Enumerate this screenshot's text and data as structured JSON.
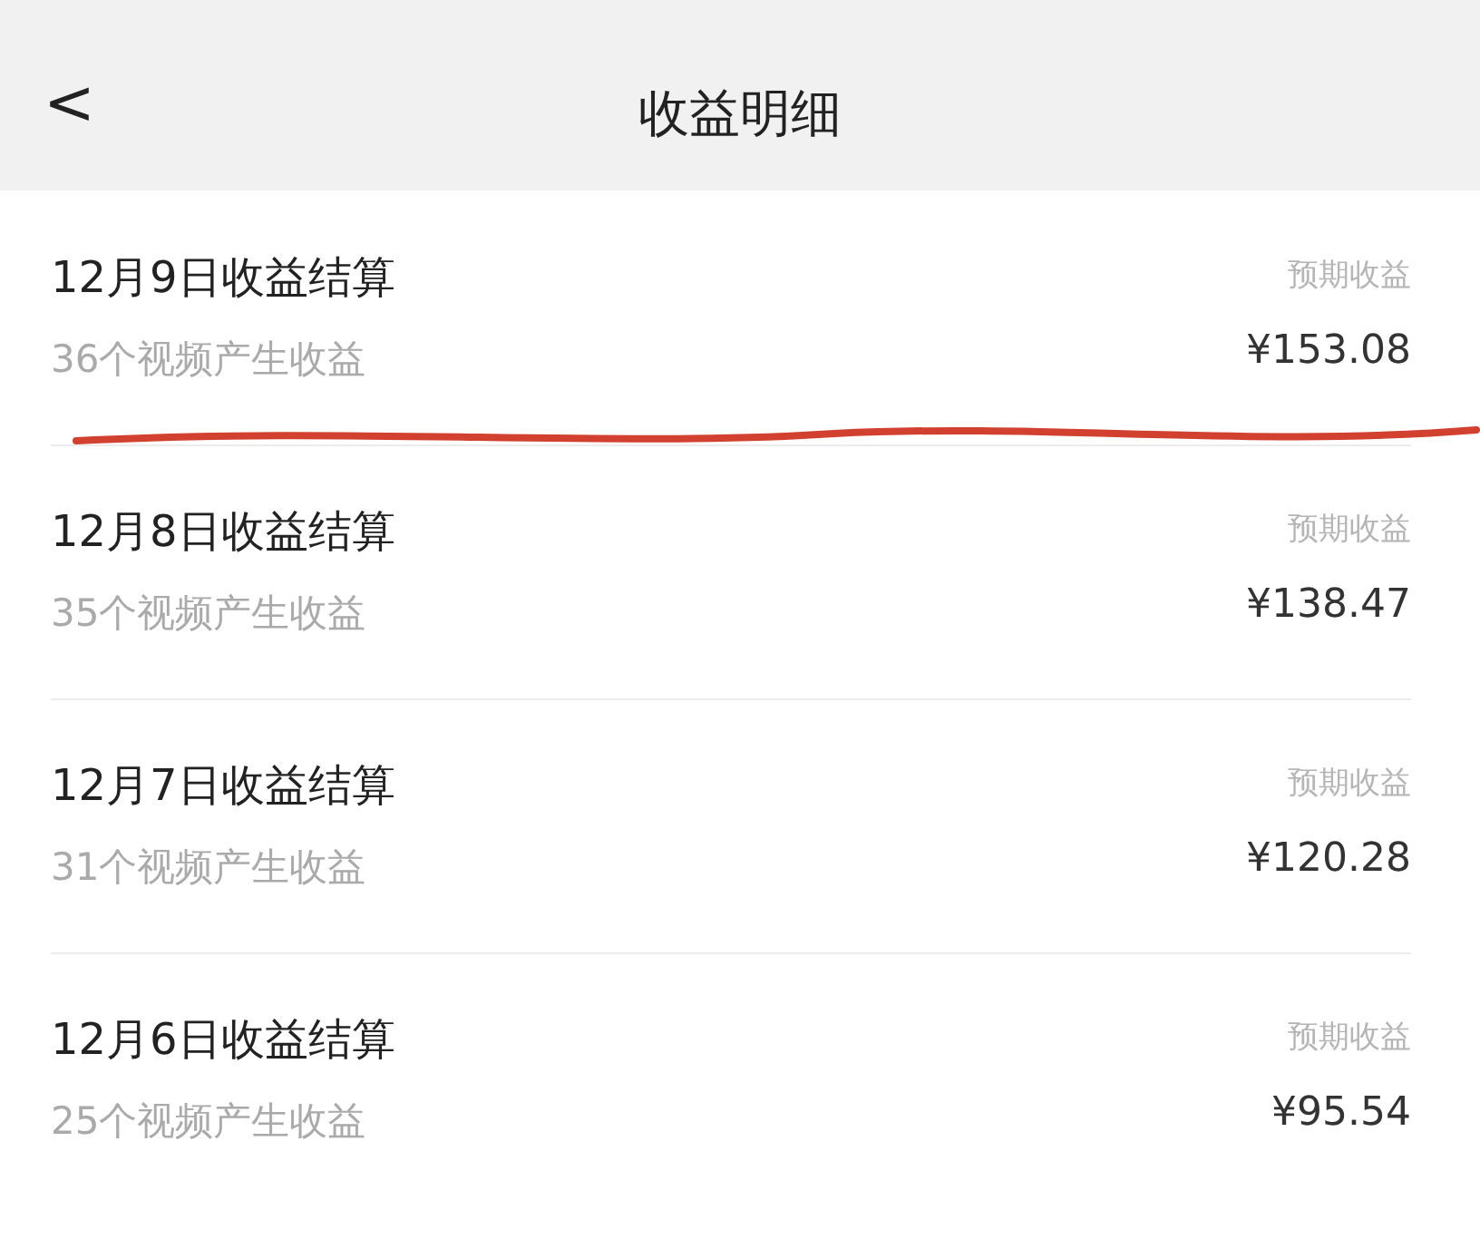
{
  "header": {
    "back": "<",
    "title": "收益明细"
  },
  "rows": [
    {
      "title": "12月9日收益结算",
      "subtitle": "36个视频产生收益",
      "label": "预期收益",
      "amount": "¥153.08",
      "underlined": true
    },
    {
      "title": "12月8日收益结算",
      "subtitle": "35个视频产生收益",
      "label": "预期收益",
      "amount": "¥138.47",
      "underlined": false
    },
    {
      "title": "12月7日收益结算",
      "subtitle": "31个视频产生收益",
      "label": "预期收益",
      "amount": "¥120.28",
      "underlined": false
    },
    {
      "title": "12月6日收益结算",
      "subtitle": "25个视频产生收益",
      "label": "预期收益",
      "amount": "¥95.54",
      "underlined": false
    }
  ]
}
